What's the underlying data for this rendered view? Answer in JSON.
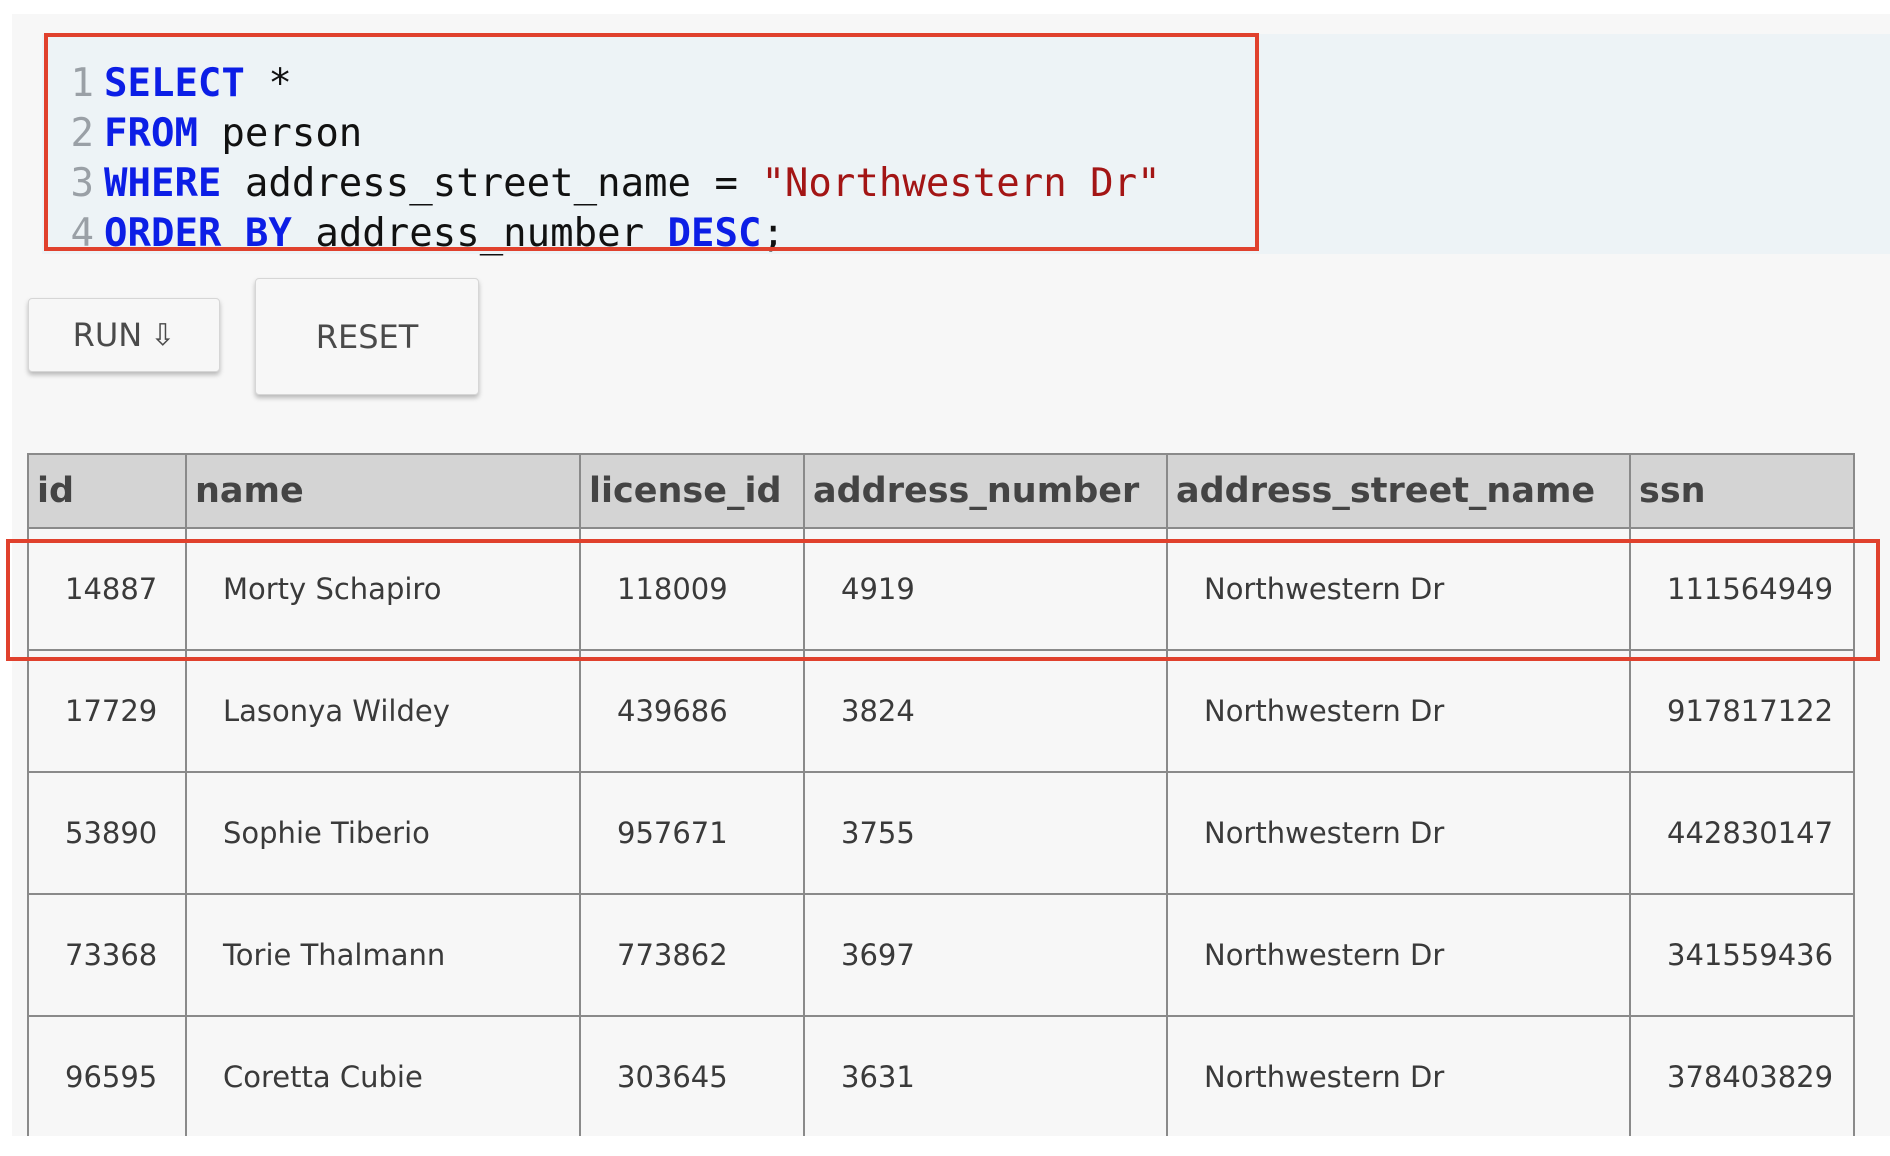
{
  "editor": {
    "lines": [
      {
        "number": "1",
        "tokens": [
          {
            "t": "SELECT",
            "k": "kw"
          },
          {
            "t": " *",
            "k": "plain"
          }
        ]
      },
      {
        "number": "2",
        "tokens": [
          {
            "t": "FROM",
            "k": "kw"
          },
          {
            "t": " person",
            "k": "plain"
          }
        ]
      },
      {
        "number": "3",
        "tokens": [
          {
            "t": "WHERE",
            "k": "kw"
          },
          {
            "t": " address_street_name = ",
            "k": "plain"
          },
          {
            "t": "\"Northwestern Dr\"",
            "k": "str"
          }
        ]
      },
      {
        "number": "4",
        "tokens": [
          {
            "t": "ORDER",
            "k": "kw"
          },
          {
            "t": " ",
            "k": "plain"
          },
          {
            "t": "BY",
            "k": "kw"
          },
          {
            "t": " address_number ",
            "k": "plain"
          },
          {
            "t": "DESC",
            "k": "kw"
          },
          {
            "t": ";",
            "k": "plain"
          }
        ]
      }
    ],
    "colors": {
      "keyword": "#0c1ee6",
      "string": "#a31515",
      "highlight": "#e0412d"
    }
  },
  "buttons": {
    "run_label": "RUN",
    "run_icon": "down-arrow-icon",
    "run_icon_glyph": "⇩",
    "reset_label": "RESET"
  },
  "table": {
    "columns": [
      "id",
      "name",
      "license_id",
      "address_number",
      "address_street_name",
      "ssn"
    ],
    "rows": [
      [
        "14887",
        "Morty Schapiro",
        "118009",
        "4919",
        "Northwestern Dr",
        "111564949"
      ],
      [
        "17729",
        "Lasonya Wildey",
        "439686",
        "3824",
        "Northwestern Dr",
        "917817122"
      ],
      [
        "53890",
        "Sophie Tiberio",
        "957671",
        "3755",
        "Northwestern Dr",
        "442830147"
      ],
      [
        "73368",
        "Torie Thalmann",
        "773862",
        "3697",
        "Northwestern Dr",
        "341559436"
      ],
      [
        "96595",
        "Coretta Cubie",
        "303645",
        "3631",
        "Northwestern Dr",
        "378403829"
      ]
    ]
  }
}
